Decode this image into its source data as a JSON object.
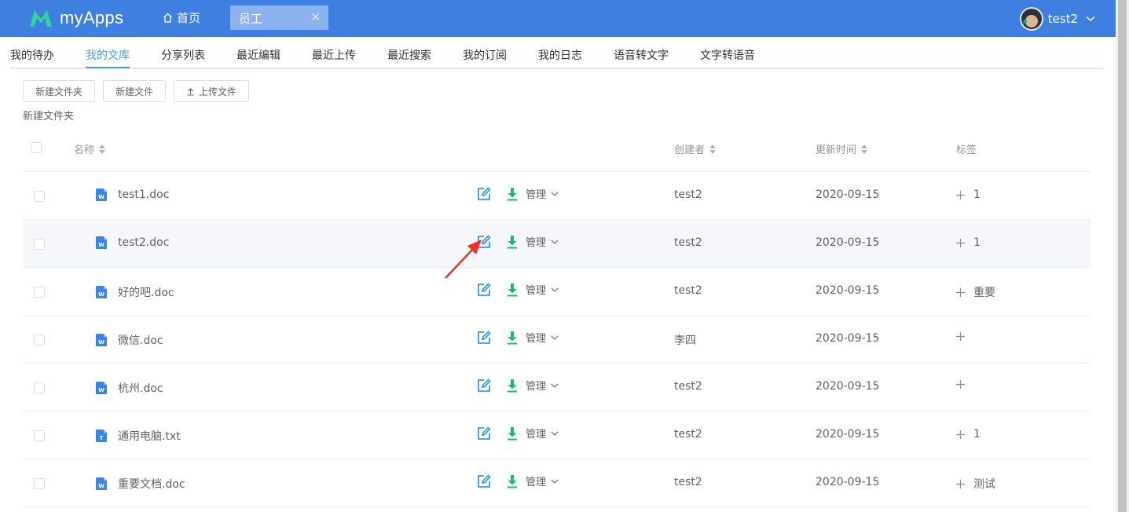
{
  "header": {
    "app_name": "myApps",
    "home_label": "首页",
    "active_tab": "员工",
    "close_glyph": "×",
    "user_name": "test2",
    "brand_color": "#3e7fe0"
  },
  "subnav": {
    "items": [
      "我的待办",
      "我的文库",
      "分享列表",
      "最近编辑",
      "最近上传",
      "最近搜索",
      "我的订阅",
      "我的日志",
      "语音转文字",
      "文字转语音"
    ],
    "active_index": 1,
    "accent_color": "#409eff"
  },
  "toolbar": {
    "new_folder": "新建文件夹",
    "new_file": "新建文件",
    "upload": "上传文件"
  },
  "breadcrumb": "新建文件夹",
  "table": {
    "columns": {
      "name": "名称",
      "creator": "创建者",
      "updated": "更新时间",
      "tags": "标签"
    },
    "manage_label": "管理",
    "rows": [
      {
        "name": "test1.doc",
        "type": "word-doc-icon",
        "creator": "test2",
        "updated": "2020-09-15",
        "tag": "1"
      },
      {
        "name": "test2.doc",
        "type": "word-doc-icon",
        "creator": "test2",
        "updated": "2020-09-15",
        "tag": "1"
      },
      {
        "name": "好的吧.doc",
        "type": "word-doc-icon",
        "creator": "test2",
        "updated": "2020-09-15",
        "tag": "重要"
      },
      {
        "name": "微信.doc",
        "type": "word-doc-icon",
        "creator": "李四",
        "updated": "2020-09-15",
        "tag": ""
      },
      {
        "name": "杭州.doc",
        "type": "word-doc-icon",
        "creator": "test2",
        "updated": "2020-09-15",
        "tag": ""
      },
      {
        "name": "通用电脑.txt",
        "type": "text-file-icon",
        "creator": "test2",
        "updated": "2020-09-15",
        "tag": "1"
      },
      {
        "name": "重要文档.doc",
        "type": "word-doc-icon",
        "creator": "test2",
        "updated": "2020-09-15",
        "tag": "测试"
      }
    ],
    "hover_row": 1
  },
  "colors": {
    "edit_icon": "#1e88e5",
    "download_icon": "#19be6b",
    "file_icon": "#3a86e8",
    "annotation_arrow": "#f0302a"
  }
}
